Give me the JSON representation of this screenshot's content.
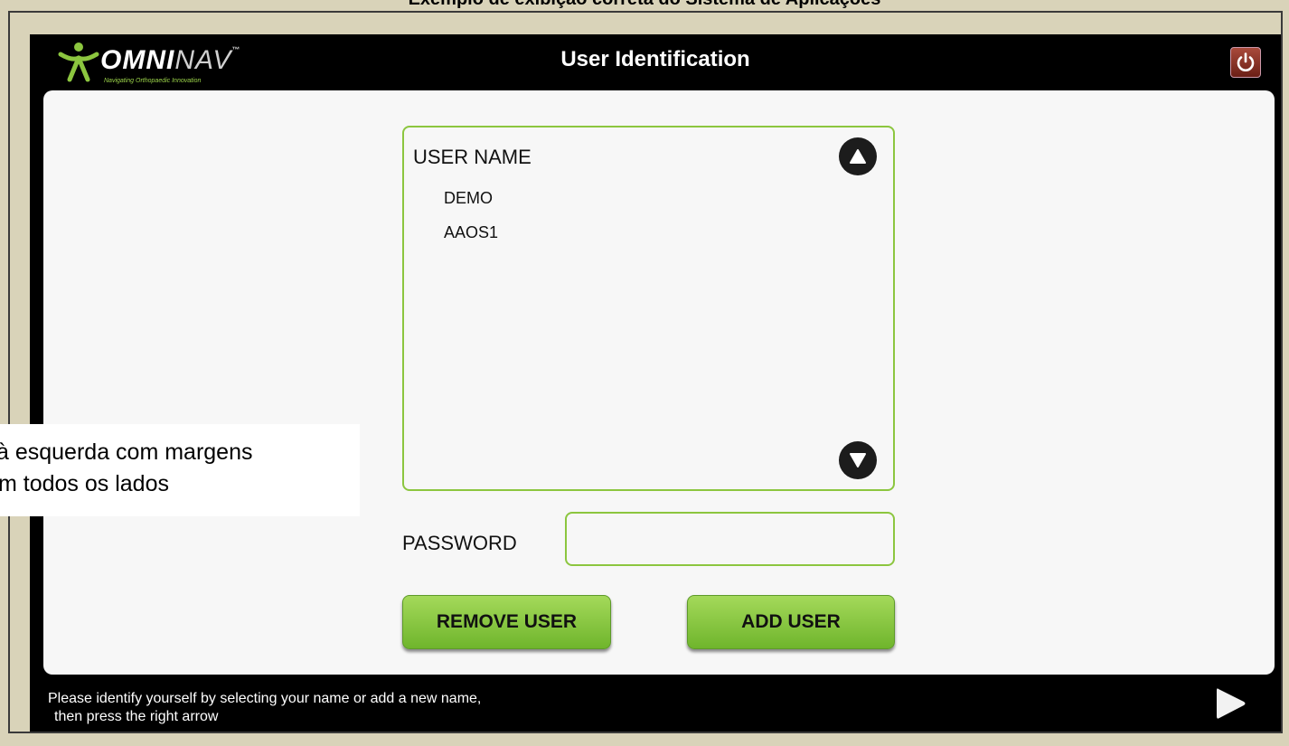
{
  "document_caption": "Exemplo de exibição correta do Sistema de Aplicações",
  "header": {
    "brand_omni": "OMNI",
    "brand_nav": "NAV",
    "brand_tm": "™",
    "tagline": "Navigating Orthopaedic Innovation",
    "title": "User Identification",
    "power_icon": "power-icon"
  },
  "user_box": {
    "heading": "USER NAME",
    "users": [
      "DEMO",
      "AAOS1"
    ]
  },
  "password": {
    "label": "PASSWORD",
    "value": ""
  },
  "buttons": {
    "remove": "REMOVE USER",
    "add": "ADD USER"
  },
  "status": {
    "line1": "Please identify yourself by selecting your name or add a new name,",
    "line2": "then press the right arrow"
  },
  "overlay_note": {
    "line1": "à esquerda com margens",
    "line2": "m todos os lados"
  },
  "colors": {
    "accent_green": "#8cc63f",
    "background": "#d9d3b9",
    "power_red": "#8b2e22"
  }
}
